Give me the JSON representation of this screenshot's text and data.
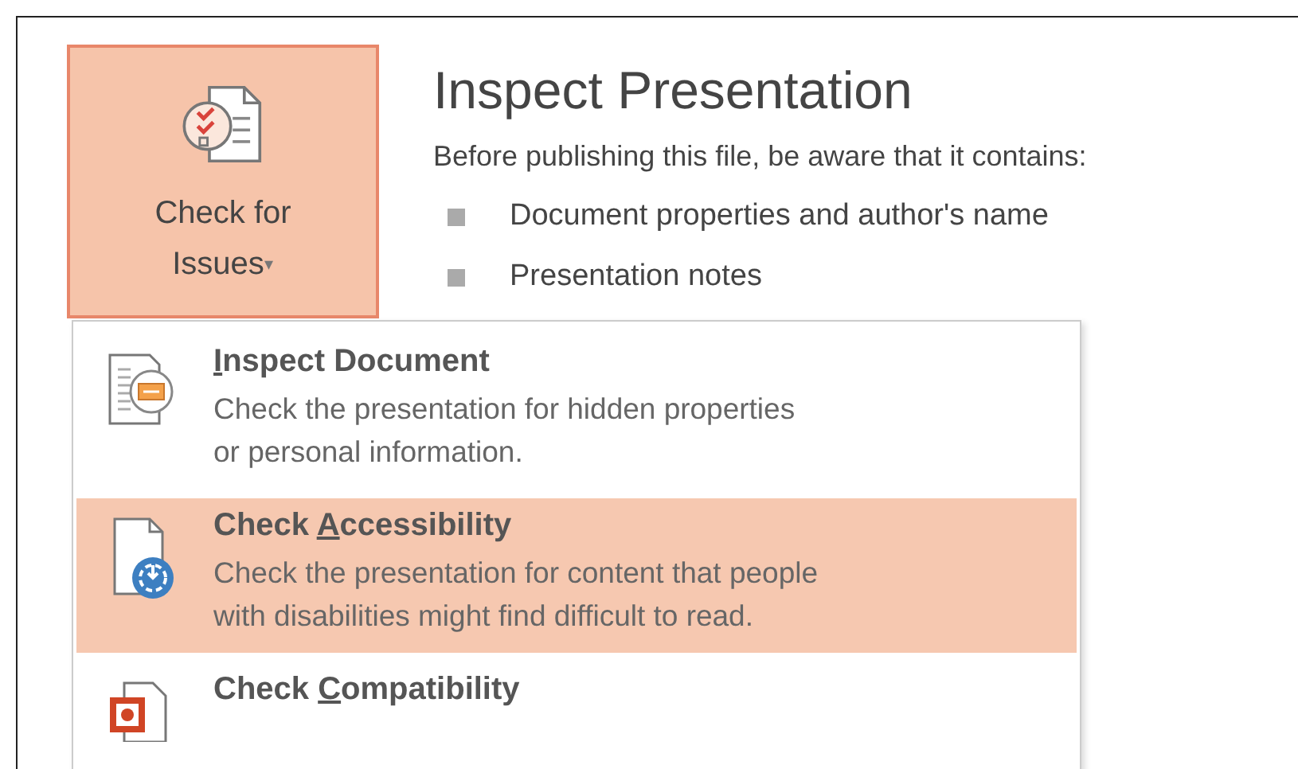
{
  "check_button": {
    "label_lines": [
      "Check for",
      "Issues"
    ],
    "caret": "▾",
    "pressed": true
  },
  "inspect": {
    "title": "Inspect Presentation",
    "intro": "Before publishing this file, be aware that it contains:",
    "bullets": [
      "Document properties and author's name",
      "Presentation notes"
    ]
  },
  "menu": {
    "items": [
      {
        "kind": "inspect",
        "access_key": "I",
        "title_rest": "nspect Document",
        "description": "Check the presentation for hidden properties\nor personal information.",
        "selected": false
      },
      {
        "kind": "accessibility",
        "title_lead": "Check",
        "access_key": "A",
        "title_rest": "ccessibility",
        "description": "Check the presentation for content that people\nwith disabilities might find difficult to read.",
        "selected": true
      },
      {
        "kind": "compatibility",
        "title_lead": "Check",
        "access_key": "C",
        "title_rest": "ompatibility",
        "selected": false
      }
    ]
  }
}
